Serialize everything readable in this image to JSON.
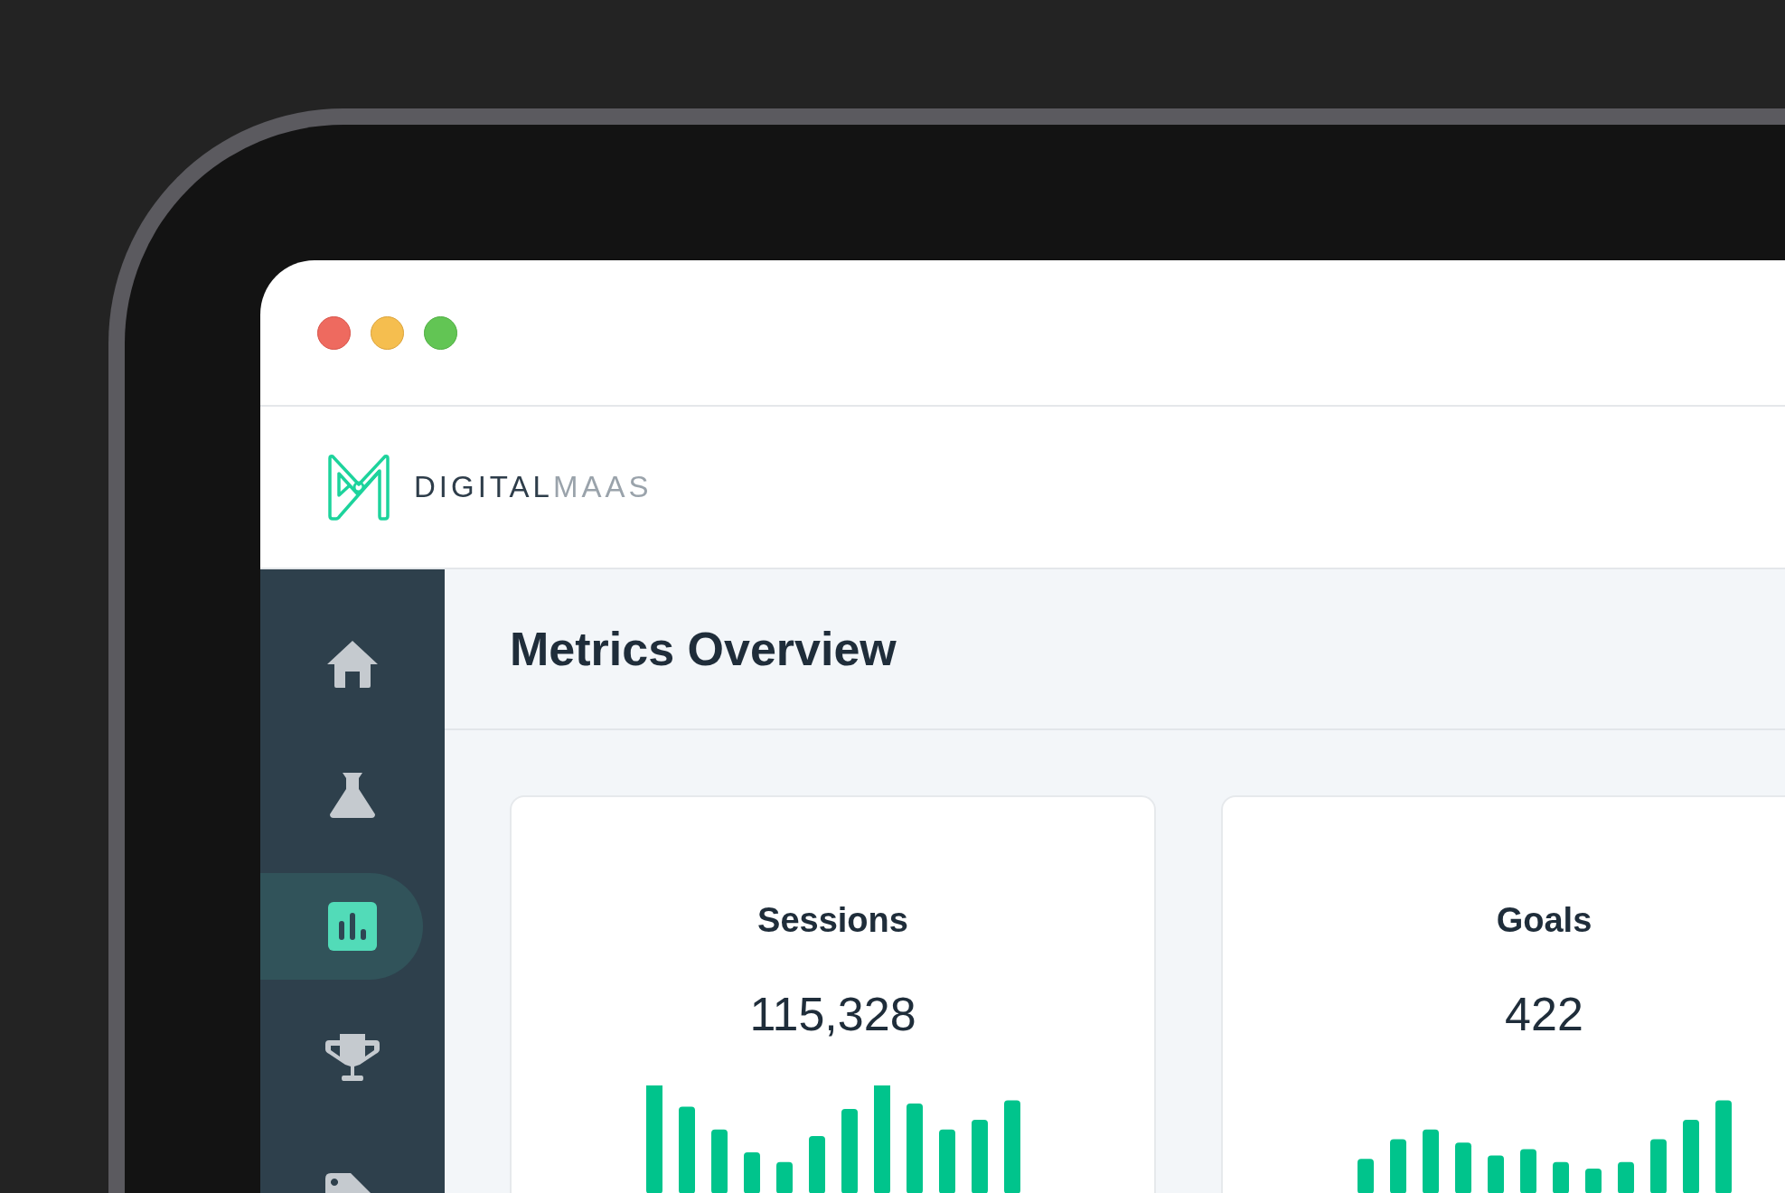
{
  "window": {
    "controls": [
      {
        "kind": "close"
      },
      {
        "kind": "minimize"
      },
      {
        "kind": "zoom"
      }
    ]
  },
  "header": {
    "logo": {
      "brand_primary": "DIGITAL",
      "brand_secondary": "MAAS"
    }
  },
  "sidebar": {
    "items": [
      {
        "kind": "home",
        "selected": false
      },
      {
        "kind": "flask",
        "selected": false
      },
      {
        "kind": "chart",
        "selected": true
      },
      {
        "kind": "trophy",
        "selected": false
      },
      {
        "kind": "tag",
        "selected": false
      }
    ]
  },
  "page": {
    "title": "Metrics Overview"
  },
  "cards": [
    {
      "title": "Sessions",
      "value": "115,328"
    },
    {
      "title": "Goals",
      "value": "422"
    }
  ]
}
